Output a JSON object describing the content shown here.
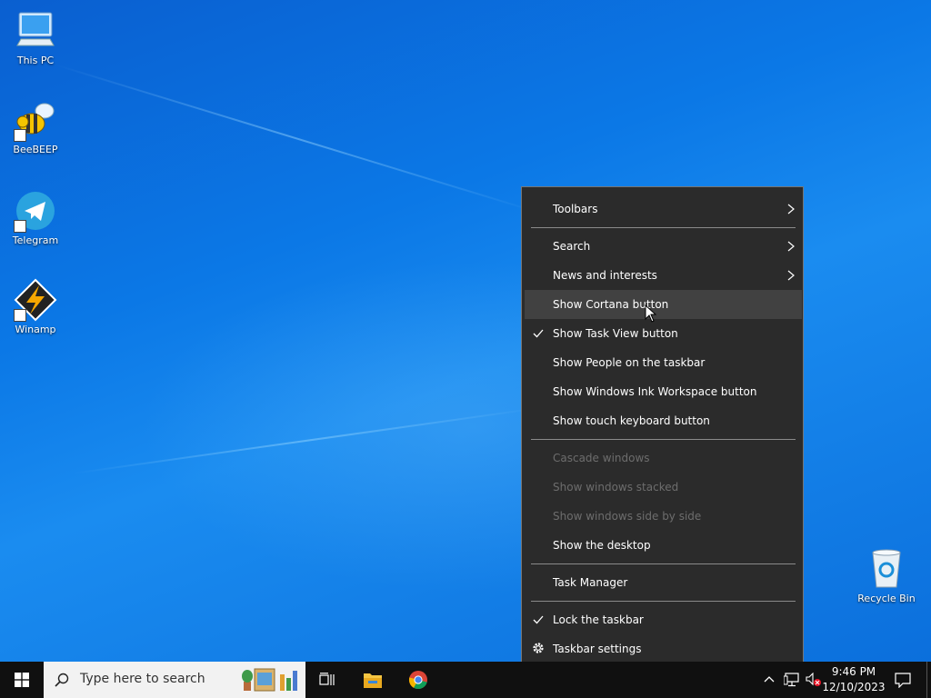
{
  "desktop": {
    "icons": [
      {
        "label": "This PC",
        "icon": "computer-icon"
      },
      {
        "label": "BeeBEEP",
        "icon": "bee-icon"
      },
      {
        "label": "Telegram",
        "icon": "telegram-icon"
      },
      {
        "label": "Winamp",
        "icon": "winamp-icon"
      },
      {
        "label": "Recycle Bin",
        "icon": "recycle-bin-icon"
      }
    ]
  },
  "context_menu": {
    "items": [
      {
        "label": "Toolbars",
        "submenu": true
      },
      {
        "label": "Search",
        "submenu": true
      },
      {
        "label": "News and interests",
        "submenu": true
      },
      {
        "label": "Show Cortana button",
        "hover": true
      },
      {
        "label": "Show Task View button",
        "checked": true
      },
      {
        "label": "Show People on the taskbar"
      },
      {
        "label": "Show Windows Ink Workspace button"
      },
      {
        "label": "Show touch keyboard button"
      },
      {
        "label": "Cascade windows",
        "disabled": true
      },
      {
        "label": "Show windows stacked",
        "disabled": true
      },
      {
        "label": "Show windows side by side",
        "disabled": true
      },
      {
        "label": "Show the desktop"
      },
      {
        "label": "Task Manager"
      },
      {
        "label": "Lock the taskbar",
        "checked": true
      },
      {
        "label": "Taskbar settings",
        "icon": "gear-icon"
      }
    ]
  },
  "taskbar": {
    "search_placeholder": "Type here to search",
    "clock_time": "9:46 PM",
    "clock_date": "12/10/2023"
  },
  "colors": {
    "menu_bg": "#2b2b2b",
    "menu_hover": "#414141",
    "taskbar_bg": "#101010",
    "desktop_accent": "#0b78e6"
  }
}
